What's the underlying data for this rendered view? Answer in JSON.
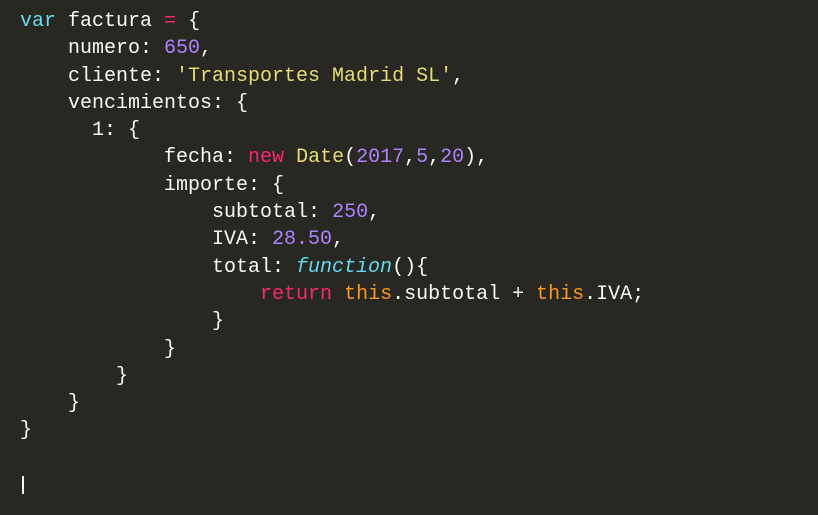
{
  "code": {
    "l1": {
      "kw": "var",
      "name": " factura ",
      "op": "=",
      "rest": " {"
    },
    "l2": {
      "key": "    numero: ",
      "num": "650",
      "rest": ","
    },
    "l3": {
      "key": "    cliente: ",
      "str": "'Transportes Madrid SL'",
      "rest": ","
    },
    "l4": {
      "key": "    vencimientos: {"
    },
    "l5": {
      "key": "      1: {"
    },
    "l6": {
      "key": "            fecha: ",
      "kw_new": "new",
      "cls": " Date",
      "paren_open": "(",
      "n1": "2017",
      "c1": ",",
      "n2": "5",
      "c2": ",",
      "n3": "20",
      "rest": "),"
    },
    "l7": {
      "key": "            importe: {"
    },
    "l8": {
      "key": "                subtotal: ",
      "num": "250",
      "rest": ","
    },
    "l9": {
      "key": "                IVA: ",
      "num": "28.50",
      "rest": ","
    },
    "l10": {
      "key": "                total: ",
      "kw_fn": "function",
      "rest": "(){"
    },
    "l11": {
      "indent": "                    ",
      "kw_ret": "return",
      "this1": " this",
      "prop1": ".subtotal ",
      "op": "+",
      "this2": " this",
      "prop2": ".IVA;"
    },
    "l12": {
      "text": "                }"
    },
    "l13": {
      "text": "            }"
    },
    "l14": {
      "text": "        }"
    },
    "l15": {
      "text": "    }"
    },
    "l16": {
      "text": "}"
    }
  },
  "colors": {
    "background": "#272822",
    "foreground": "#f8f8f2",
    "keyword_pink": "#f92672",
    "keyword_blue": "#66d9ef",
    "number_purple": "#ae81ff",
    "string_yellow": "#e6db74",
    "this_orange": "#fd971f"
  }
}
